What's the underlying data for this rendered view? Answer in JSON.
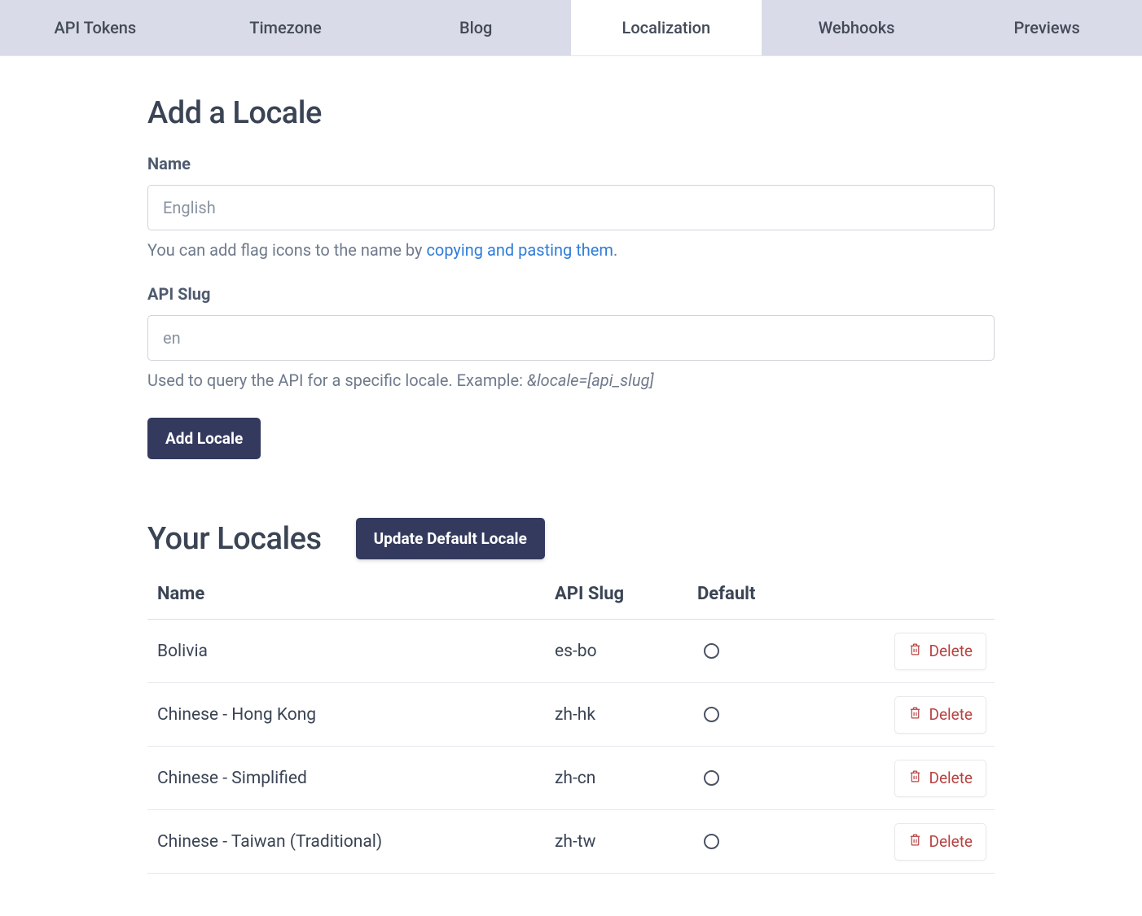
{
  "tabs": [
    {
      "label": "API Tokens",
      "active": false
    },
    {
      "label": "Timezone",
      "active": false
    },
    {
      "label": "Blog",
      "active": false
    },
    {
      "label": "Localization",
      "active": true
    },
    {
      "label": "Webhooks",
      "active": false
    },
    {
      "label": "Previews",
      "active": false
    }
  ],
  "add_locale": {
    "title": "Add a Locale",
    "name_label": "Name",
    "name_placeholder": "English",
    "hint_prefix": "You can add flag icons to the name by ",
    "hint_link": "copying and pasting them",
    "hint_suffix": ".",
    "slug_label": "API Slug",
    "slug_placeholder": "en",
    "slug_hint_text": "Used to query the API for a specific locale. Example: ",
    "slug_hint_example": "&locale=[api_slug]",
    "button_label": "Add Locale"
  },
  "your_locales": {
    "title": "Your Locales",
    "update_button": "Update Default Locale",
    "headers": {
      "name": "Name",
      "slug": "API Slug",
      "default": "Default"
    },
    "delete_label": "Delete",
    "rows": [
      {
        "name": "Bolivia",
        "slug": "es-bo",
        "default": false
      },
      {
        "name": "Chinese - Hong Kong",
        "slug": "zh-hk",
        "default": false
      },
      {
        "name": "Chinese - Simplified",
        "slug": "zh-cn",
        "default": false
      },
      {
        "name": "Chinese - Taiwan (Traditional)",
        "slug": "zh-tw",
        "default": false
      }
    ]
  }
}
